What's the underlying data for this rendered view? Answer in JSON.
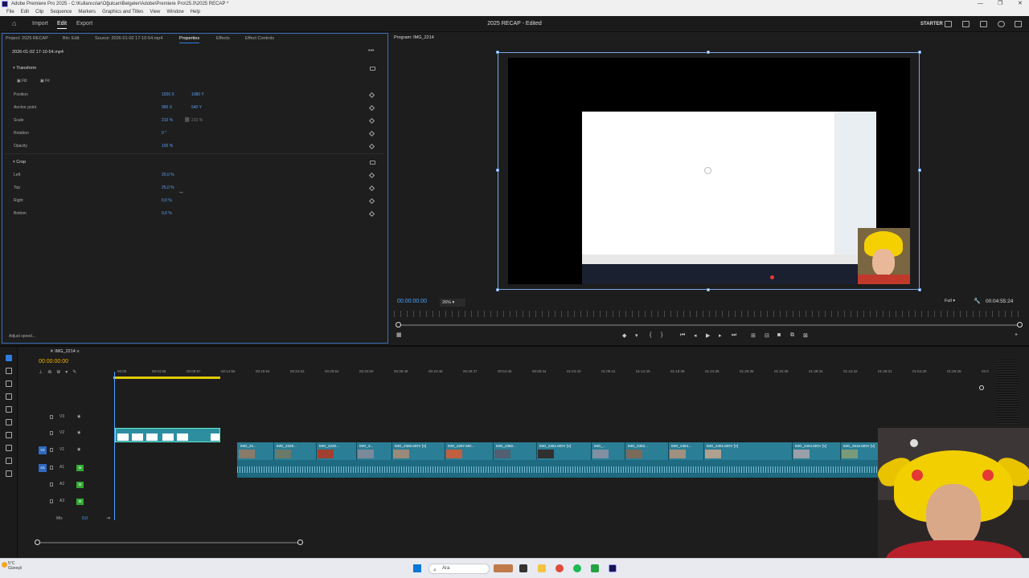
{
  "window": {
    "title": "Adobe Premiere Pro 2025 - C:\\Kullanıcılar\\Oğulcan\\Belgeler\\Adobe\\Premiere Pro\\25.0\\2025 RECAP *",
    "menu": [
      "File",
      "Edit",
      "Clip",
      "Sequence",
      "Markers",
      "Graphics and Titles",
      "View",
      "Window",
      "Help"
    ],
    "controls": [
      "—",
      "❐",
      "✕"
    ]
  },
  "header": {
    "nav": [
      "Import",
      "Edit",
      "Export"
    ],
    "active_nav": "Edit",
    "project_title": "2025 RECAP - Edited",
    "workspace": "STARTER"
  },
  "left_panel": {
    "tabs": [
      "Project: 2025 RECAP",
      "Bin: Edit",
      "Source: 2026-01-02 17-10-54.mp4",
      "Properties",
      "Effects",
      "Effect Controls"
    ],
    "active_tab": "Properties",
    "clip_name": "2026-01-02 17-10-54.mp4",
    "transform": {
      "title": "Transform",
      "fill_label": "Fill",
      "fit_label": "Fit",
      "position": {
        "label": "Position",
        "x": "1920 X",
        "y": "1080 Y"
      },
      "anchor": {
        "label": "Anchor point",
        "x": "960 X",
        "y": "540 Y"
      },
      "scale": {
        "label": "Scale",
        "value": "210 %",
        "secondary": "210 %"
      },
      "rotation": {
        "label": "Rotation",
        "value": "0 °"
      },
      "opacity": {
        "label": "Opacity",
        "value": "100 %"
      }
    },
    "crop": {
      "title": "Crop",
      "left": {
        "label": "Left",
        "value": "20,0 %"
      },
      "top": {
        "label": "Top",
        "value": "25,0 %"
      },
      "right": {
        "label": "Right",
        "value": "0,0 %"
      },
      "bottom": {
        "label": "Bottom",
        "value": "0,0 %"
      }
    },
    "footer": "Adjust speed..."
  },
  "program": {
    "label": "Program: IMG_2214",
    "timecode": "00:00:00:00",
    "zoom": "26%",
    "quality": "Full",
    "duration": "00:04:55:24"
  },
  "timeline": {
    "sequence_tab": "IMG_2214",
    "timecode": "00:00:00:00",
    "ruler": [
      "00:00",
      "00:04:58",
      "00:09:57",
      "00:14:56",
      "00:19:54",
      "00:24:53",
      "00:29:52",
      "00:34:50",
      "00:39:49",
      "00:44:48",
      "00:49:47",
      "00:54:45",
      "00:59:44",
      "01:04:43",
      "01:09:41",
      "01:14:40",
      "01:19:39",
      "01:24:38",
      "01:29:36",
      "01:34:35",
      "01:39:34",
      "01:44:32",
      "01:49:31",
      "01:54:30",
      "01:59:28",
      "02:0"
    ],
    "tracks": [
      {
        "name": "V3",
        "src": "",
        "kind": "video"
      },
      {
        "name": "V2",
        "src": "",
        "kind": "video"
      },
      {
        "name": "V1",
        "src": "V1",
        "kind": "video"
      },
      {
        "name": "A1",
        "src": "A1",
        "kind": "audio",
        "m": "M"
      },
      {
        "name": "A2",
        "src": "",
        "kind": "audio",
        "m": "M"
      },
      {
        "name": "A3",
        "src": "",
        "kind": "audio",
        "m": "M"
      }
    ],
    "mix_label": "Mix",
    "mix_value": "0,0",
    "v1_clips": [
      "IMG_22...",
      "IMG_2229...",
      "IMG_2230...",
      "IMG_3...",
      "IMG_2306.MOV [V]",
      "IMG_2297.MO...",
      "IMG_2350...",
      "IMG_2351.MOV [V]",
      "IMG_...",
      "IMG_2353...",
      "IMG_2364...",
      "IMG_2401.MOV [V]",
      "IMG_2404.MOV [V]",
      "IMG_2516.MOV [V]"
    ]
  },
  "taskbar": {
    "weather_temp": "5°C",
    "weather_desc": "Güneşli",
    "search_placeholder": "Ara"
  },
  "colors": {
    "accent": "#2f7de0",
    "timecode": "#4aa3ff",
    "clip_video": "#2a7e96",
    "clip_audio": "#1e6a80",
    "work_area": "#e0c900"
  }
}
